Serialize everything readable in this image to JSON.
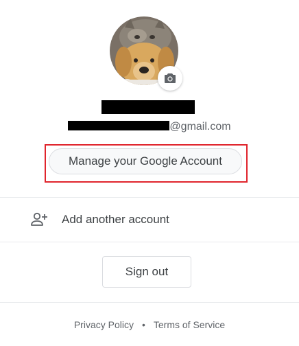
{
  "account": {
    "email_suffix": "@gmail.com"
  },
  "actions": {
    "manage_label": "Manage your Google Account",
    "add_account_label": "Add another account",
    "sign_out_label": "Sign out"
  },
  "footer": {
    "privacy_label": "Privacy Policy",
    "separator": "•",
    "terms_label": "Terms of Service"
  },
  "icons": {
    "avatar": "profile-photo",
    "camera": "camera-icon",
    "add_person": "person-add-icon"
  },
  "colors": {
    "highlight": "#e0242c",
    "text": "#3c4043",
    "muted": "#5f6368",
    "divider": "#e8eaed"
  }
}
